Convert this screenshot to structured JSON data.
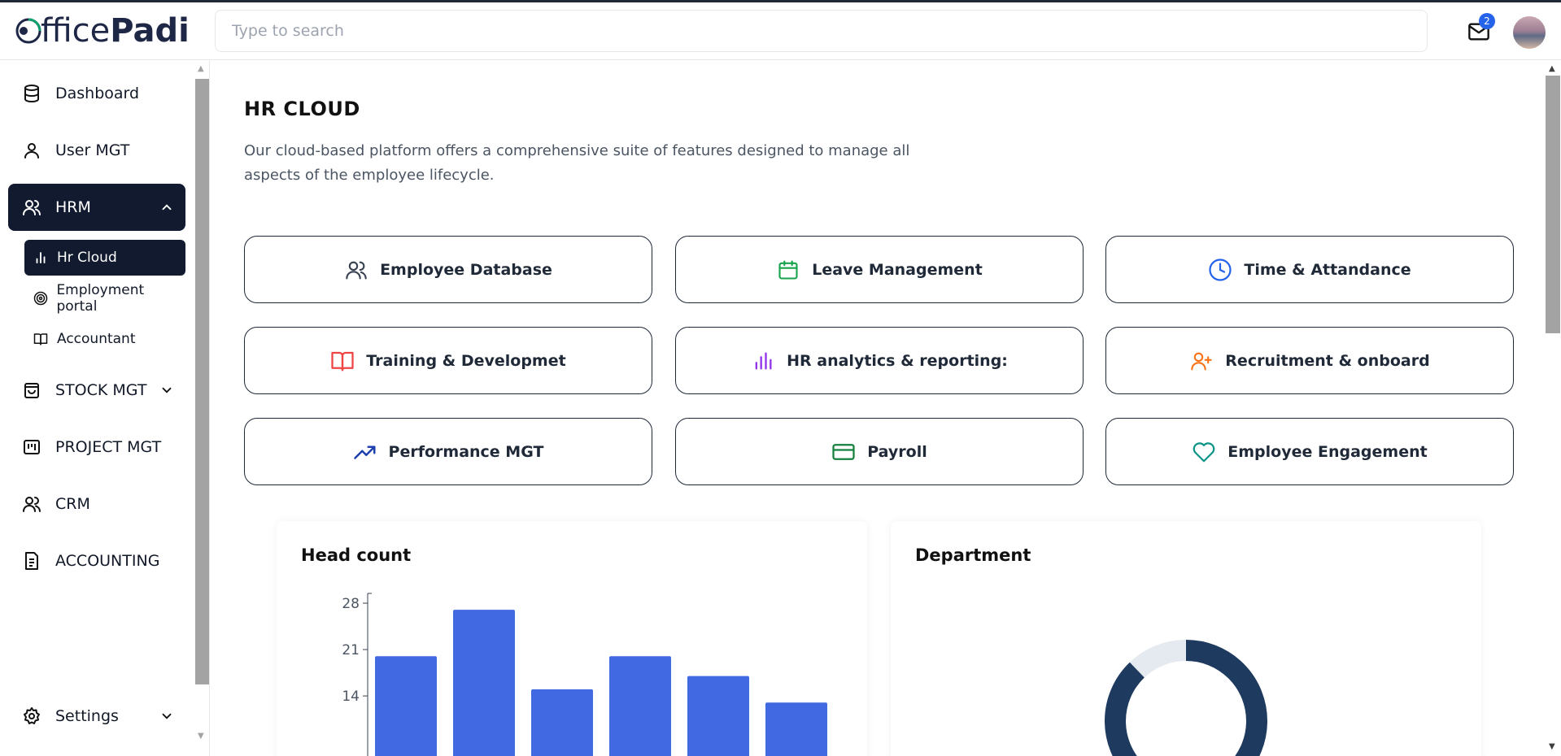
{
  "app": {
    "brand": "OfficePadi"
  },
  "header": {
    "search_placeholder": "Type to search",
    "notification_count": "2"
  },
  "sidebar": {
    "items": [
      {
        "label": "Dashboard"
      },
      {
        "label": "User MGT"
      },
      {
        "label": "HRM"
      },
      {
        "label": "STOCK MGT"
      },
      {
        "label": "PROJECT MGT"
      },
      {
        "label": "CRM"
      },
      {
        "label": "ACCOUNTING"
      },
      {
        "label": "Settings"
      }
    ],
    "hrm_sub": [
      {
        "label": "Hr Cloud"
      },
      {
        "label": "Employment portal"
      },
      {
        "label": "Accountant"
      }
    ]
  },
  "main": {
    "title": "HR CLOUD",
    "description": "Our cloud-based platform offers a comprehensive suite of features designed to manage all aspects of the employee lifecycle.",
    "cards": [
      {
        "label": "Employee Database",
        "icon": "users-icon",
        "color": "#374151"
      },
      {
        "label": "Leave Management",
        "icon": "calendar-icon",
        "color": "#16a34a"
      },
      {
        "label": "Time & Attandance",
        "icon": "clock-icon",
        "color": "#2563eb"
      },
      {
        "label": "Training & Developmet",
        "icon": "book-icon",
        "color": "#ef4444"
      },
      {
        "label": "HR analytics & reporting:",
        "icon": "bar-chart-icon",
        "color": "#9333ea"
      },
      {
        "label": "Recruitment & onboard",
        "icon": "user-plus-icon",
        "color": "#f97316"
      },
      {
        "label": "Performance MGT",
        "icon": "trending-up-icon",
        "color": "#1e40af"
      },
      {
        "label": "Payroll",
        "icon": "credit-card-icon",
        "color": "#15803d"
      },
      {
        "label": "Employee Engagement",
        "icon": "heart-icon",
        "color": "#0d9488"
      }
    ],
    "headcount_title": "Head count",
    "department_title": "Department"
  },
  "chart_data": [
    {
      "type": "bar",
      "title": "Head count",
      "y_ticks": [
        "28",
        "21",
        "14"
      ],
      "values": [
        20,
        27,
        15,
        20,
        17,
        13
      ],
      "ylim": [
        0,
        29
      ],
      "color": "#4169e1"
    },
    {
      "type": "pie",
      "title": "Department",
      "colors": [
        "#1e3a5f",
        "#e5e9f0"
      ]
    }
  ]
}
